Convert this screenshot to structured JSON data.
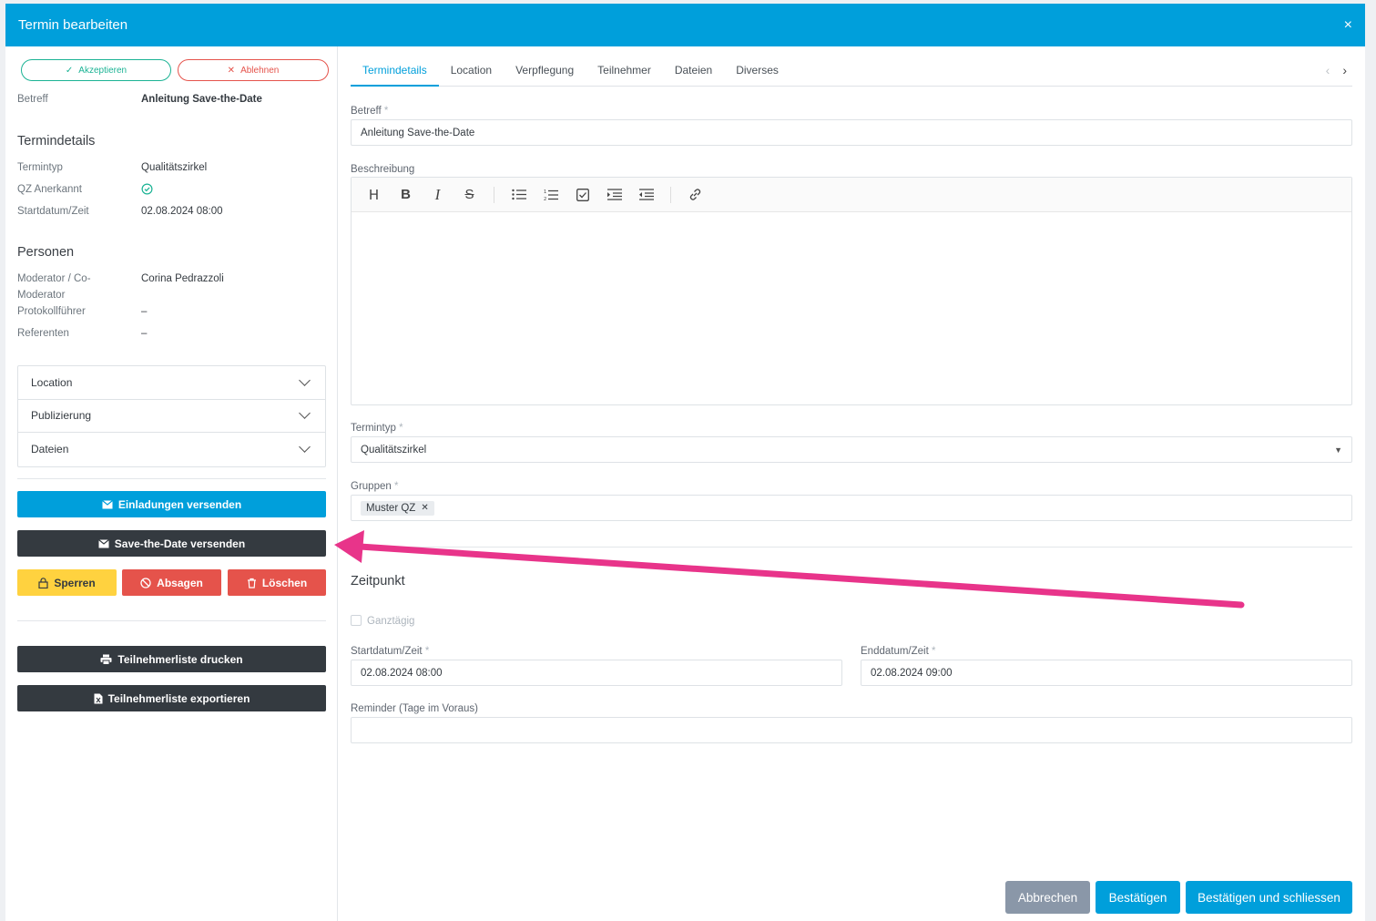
{
  "modal": {
    "title": "Termin bearbeiten",
    "close": "×"
  },
  "sidebar": {
    "accept_label": "Akzeptieren",
    "reject_label": "Ablehnen",
    "betreff_key": "Betreff",
    "betreff_val": "Anleitung Save-the-Date",
    "termindetails_heading": "Termindetails",
    "termintyp_key": "Termintyp",
    "termintyp_val": "Qualitätszirkel",
    "qz_key": "QZ Anerkannt",
    "start_key": "Startdatum/Zeit",
    "start_val": "02.08.2024 08:00",
    "personen_heading": "Personen",
    "moderator_key_1": "Moderator / Co-",
    "moderator_key_2": "Moderator",
    "moderator_val": "Corina Pedrazzoli",
    "protokoll_key": "Protokollführer",
    "protokoll_val": "–",
    "referenten_key": "Referenten",
    "referenten_val": "–",
    "accordion": [
      "Location",
      "Publizierung",
      "Dateien"
    ],
    "invite_btn": "Einladungen versenden",
    "save_date_btn": "Save-the-Date versenden",
    "lock_btn": "Sperren",
    "cancel_btn": "Absagen",
    "delete_btn": "Löschen",
    "print_btn": "Teilnehmerliste drucken",
    "export_btn": "Teilnehmerliste exportieren"
  },
  "tabs": [
    "Termindetails",
    "Location",
    "Verpflegung",
    "Teilnehmer",
    "Dateien",
    "Diverses"
  ],
  "form": {
    "betreff_label": "Betreff",
    "betreff_value": "Anleitung Save-the-Date",
    "beschreibung_label": "Beschreibung",
    "termintyp_label": "Termintyp",
    "termintyp_value": "Qualitätszirkel",
    "gruppen_label": "Gruppen",
    "gruppen_tag": "Muster QZ",
    "zeitpunkt_heading": "Zeitpunkt",
    "ganztaegig_label": "Ganztägig",
    "start_label": "Startdatum/Zeit",
    "start_value": "02.08.2024 08:00",
    "end_label": "Enddatum/Zeit",
    "end_value": "02.08.2024 09:00",
    "reminder_label": "Reminder (Tage im Voraus)",
    "required_mark": "*"
  },
  "footer": {
    "abbrechen": "Abbrechen",
    "bestaetigen": "Bestätigen",
    "bestaetigen_schliessen": "Bestätigen und schliessen"
  },
  "colors": {
    "primary": "#009fdb",
    "dark": "#343a40",
    "success": "#1bb394",
    "danger": "#e5534b",
    "warning": "#ffd23f",
    "arrow": "#e8348a"
  }
}
